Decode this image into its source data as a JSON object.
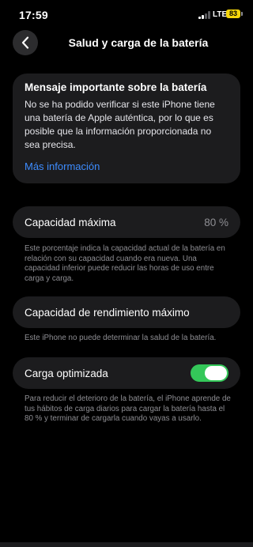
{
  "status_bar": {
    "time": "17:59",
    "network": "LTE",
    "battery_level": "83",
    "battery_color": "#f5d60a"
  },
  "nav": {
    "back_icon": "chevron-left-icon",
    "title": "Salud y carga de la batería"
  },
  "notice": {
    "title": "Mensaje importante sobre la batería",
    "body": "No se ha podido verificar si este iPhone tiene una batería de Apple auténtica, por lo que es posible que la información proporcionada no sea precisa.",
    "link": "Más información"
  },
  "max_capacity": {
    "label": "Capacidad máxima",
    "value": "80 %",
    "footnote": "Este porcentaje indica la capacidad actual de la batería en relación con su capacidad cuando era nueva. Una capacidad inferior puede reducir las horas de uso entre carga y carga."
  },
  "peak_performance": {
    "label": "Capacidad de rendimiento máximo",
    "footnote": "Este iPhone no puede determinar la salud de la batería."
  },
  "optimized_charging": {
    "label": "Carga optimizada",
    "enabled": true,
    "footnote": "Para reducir el deterioro de la batería, el iPhone aprende de tus hábitos de carga diarios para cargar la batería hasta el 80 % y terminar de cargarla cuando vayas a usarlo."
  },
  "colors": {
    "background": "#000000",
    "card": "#1c1c1e",
    "accent_link": "#3d8cff",
    "toggle_on": "#34c759",
    "secondary_text": "#8e8e93"
  }
}
